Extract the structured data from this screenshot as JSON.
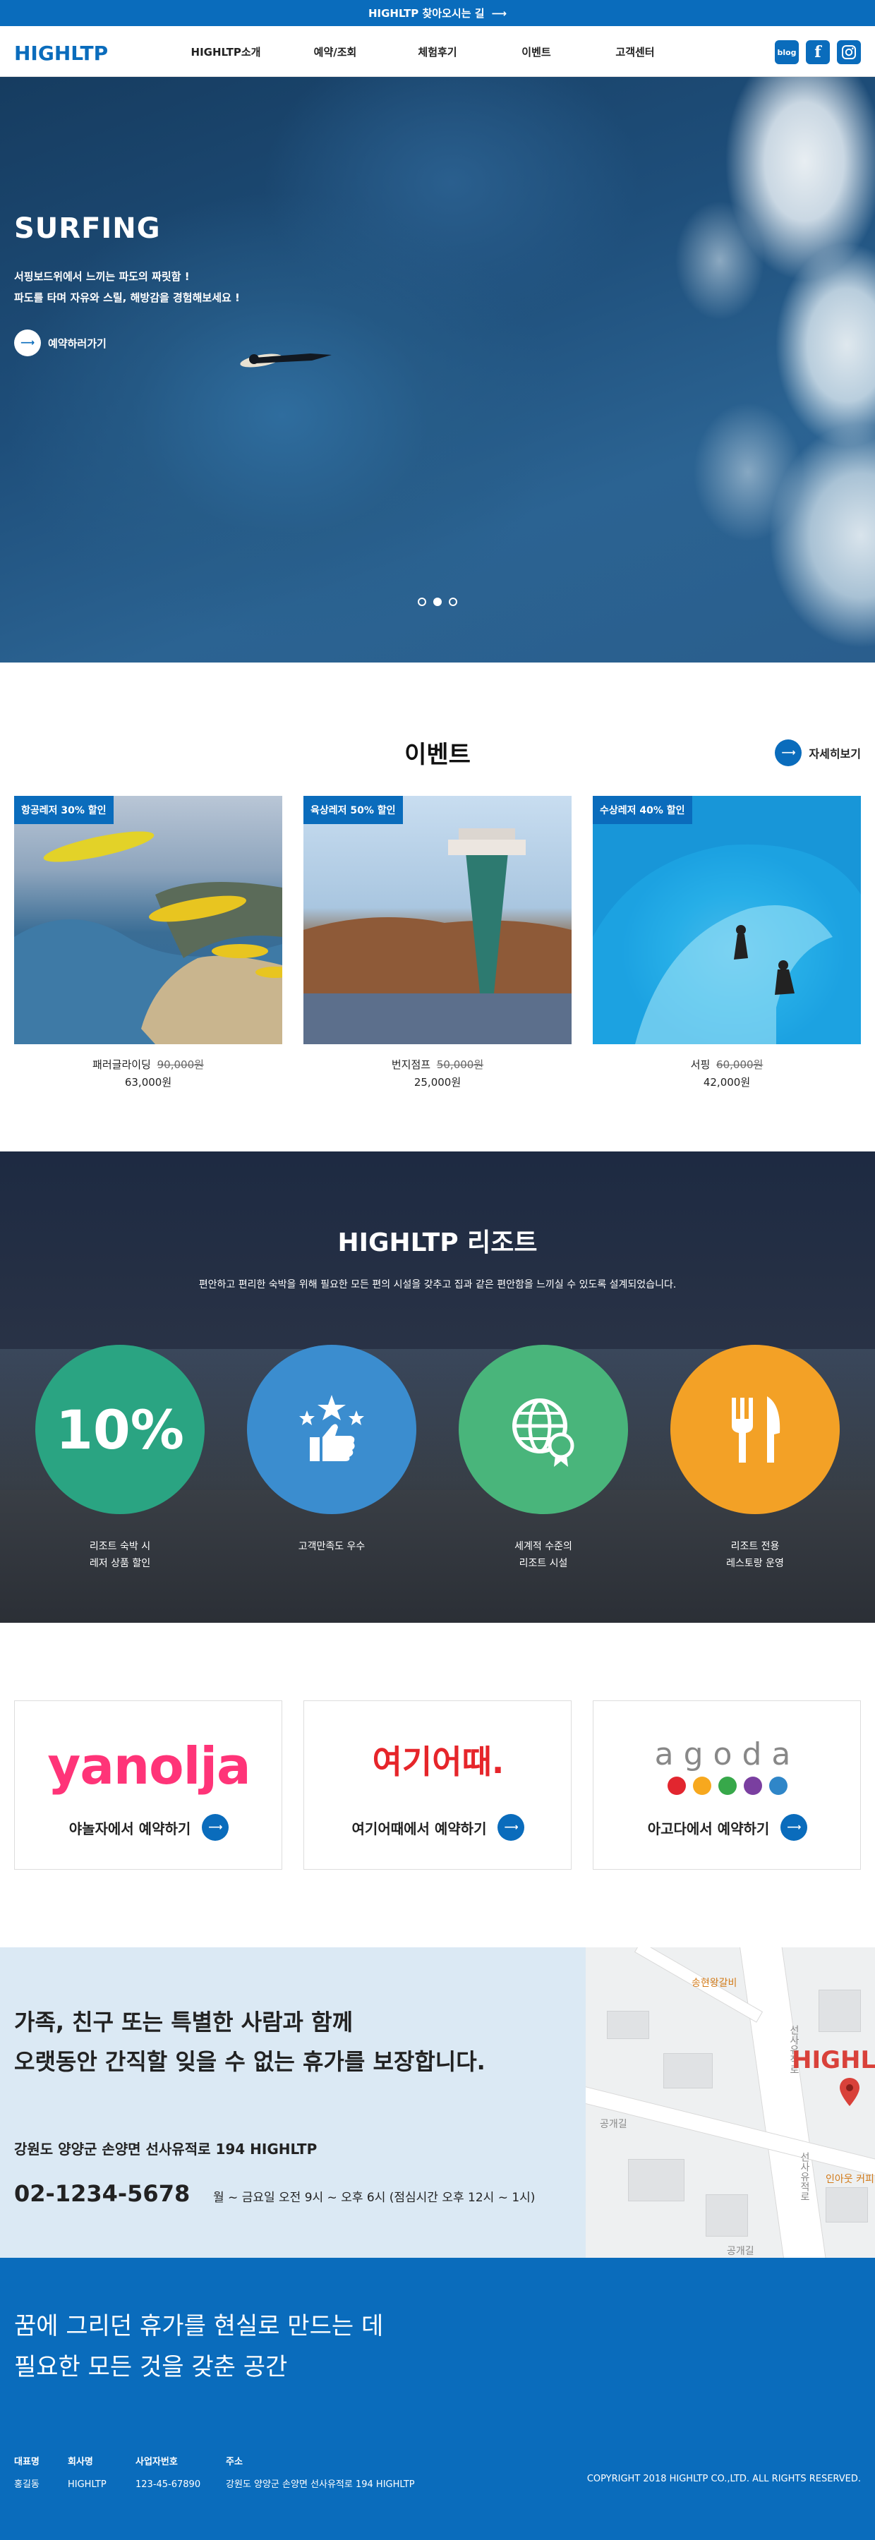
{
  "topbar": {
    "text": "HIGHLTP 찾아오시는 길",
    "arrow": "⟶"
  },
  "header": {
    "logo": "HIGHLTP",
    "nav": [
      "HIGHLTP소개",
      "예약/조회",
      "체험후기",
      "이벤트",
      "고객센터"
    ],
    "social": {
      "blog": "blog",
      "facebook": "f",
      "instagram": "instagram-icon"
    }
  },
  "hero": {
    "title": "SURFING",
    "sub_line1": "서핑보드위에서 느끼는 파도의 짜릿함 !",
    "sub_line2": "파도를 타며 자유와 스릴, 해방감을 경험해보세요 !",
    "cta": "예약하러가기",
    "slides": 3,
    "active_slide": 2
  },
  "events": {
    "title": "이벤트",
    "more": "자세히보기",
    "items": [
      {
        "tag": "항공레저 30% 할인",
        "name": "패러글라이딩",
        "old_price": "90,000원",
        "price": "63,000원"
      },
      {
        "tag": "육상레저 50% 할인",
        "name": "번지점프",
        "old_price": "50,000원",
        "price": "25,000원"
      },
      {
        "tag": "수상레저 40% 할인",
        "name": "서핑",
        "old_price": "60,000원",
        "price": "42,000원"
      }
    ]
  },
  "resort": {
    "title": "HIGHLTP 리조트",
    "desc": "편안하고 편리한 숙박을 위해 필요한 모든 편의 시설을 갖추고 집과 같은 편안함을 느끼실 수 있도록 설계되었습니다.",
    "features": [
      {
        "big": "10%",
        "label": "리조트 숙박 시\n레저 상품 할인",
        "color": "#2aa482",
        "icon": "percent-badge"
      },
      {
        "big": "",
        "label": "고객만족도 우수",
        "color": "#3b8dcf",
        "icon": "thumbs-up-stars-icon"
      },
      {
        "big": "",
        "label": "세계적 수준의\n리조트 시설",
        "color": "#49b57b",
        "icon": "globe-award-icon"
      },
      {
        "big": "",
        "label": "리조트 전용\n레스토랑 운영",
        "color": "#f3a126",
        "icon": "fork-knife-icon"
      }
    ]
  },
  "partners": [
    {
      "brand": "yanolja",
      "book": "야놀자에서 예약하기",
      "color": "#ff3478"
    },
    {
      "brand": "여기어때.",
      "book": "여기어때에서 예약하기",
      "color": "#e6252a"
    },
    {
      "brand": "agoda",
      "book": "아고다에서 예약하기",
      "color": "#888888"
    }
  ],
  "info": {
    "tagline": "가족, 친구 또는 특별한 사람과 함께\n오랫동안 간직할 잊을 수 없는 휴가를 보장합니다.",
    "address": "강원도 양양군 손양면 선사유적로 194 HIGHLTP",
    "phone": "02-1234-5678",
    "hours": "월 ~ 금요일 오전 9시 ~ 오후 6시 (점심시간 오후 12시 ~ 1시)"
  },
  "map": {
    "place": "HIGHL",
    "labels": [
      "송현왕갈비",
      "선사유적로",
      "선사유적로",
      "인아웃 커피",
      "공개길",
      "공개길"
    ]
  },
  "footer": {
    "slogan": "꿈에 그리던 휴가를 현실로 만드는 데\n필요한 모든 것을 갖춘 공간",
    "cols": [
      {
        "h": "대표명",
        "v": "홍길동"
      },
      {
        "h": "회사명",
        "v": "HIGHLTP"
      },
      {
        "h": "사업자번호",
        "v": "123-45-67890"
      },
      {
        "h": "주소",
        "v": "강원도 양양군 손양면 선사유적로 194 HIGHLTP"
      }
    ],
    "copyright": "COPYRIGHT 2018 HIGHLTP CO.,LTD. ALL RIGHTS RESERVED."
  }
}
